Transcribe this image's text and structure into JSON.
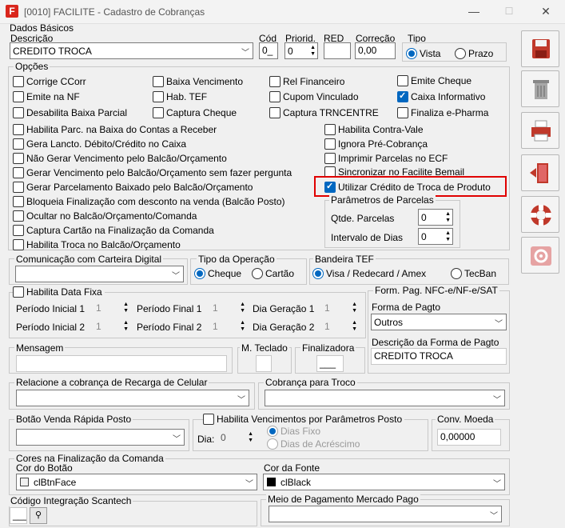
{
  "window": {
    "title": "[0010] FACILITE - Cadastro de Cobranças",
    "icon_letter": "F"
  },
  "dados_basicos": {
    "legend": "Dados Básicos",
    "descricao_label": "Descrição",
    "descricao_value": "CREDITO TROCA",
    "cod_label": "Cód",
    "cod_value": "0_",
    "prioridade_label": "Priorid.",
    "prioridade_value": "0",
    "red_label": "RED",
    "red_value": "",
    "correcao_label": "Correção",
    "correcao_value": "0,00",
    "tipo_label": "Tipo",
    "tipo_vista": "Vista",
    "tipo_prazo": "Prazo"
  },
  "opcoes": {
    "legend": "Opções",
    "row1": [
      "Corrige CCorr",
      "Baixa Vencimento",
      "Rel Financeiro",
      "Emite Cheque"
    ],
    "row2": [
      "Emite na NF",
      "Hab. TEF",
      "Cupom Vinculado",
      "Caixa Informativo"
    ],
    "row3": [
      "Desabilita Baixa Parcial",
      "Captura Cheque",
      "Captura TRNCENTRE",
      "Finaliza e-Pharma"
    ],
    "left": [
      "Habilita Parc. na Baixa do Contas a Receber",
      "Gera Lancto. Débito/Crédito no Caixa",
      "Não Gerar Vencimento pelo Balcão/Orçamento",
      "Gerar Vencimento pelo Balcão/Orçamento sem fazer pergunta",
      "Gerar Parcelamento Baixado pelo Balcão/Orçamento",
      "Bloqueia Finalização com desconto na venda (Balcão Posto)",
      "Ocultar no Balcão/Orçamento/Comanda",
      "Captura Cartão na Finalização da Comanda",
      "Habilita Troca no Balcão/Orçamento"
    ],
    "right": [
      "Habilita Contra-Vale",
      "Ignora Pré-Cobrança",
      "Imprimir Parcelas no ECF",
      "Sincronizar no Facilite Bemail",
      "Utilizar Crédito de Troca de Produto"
    ]
  },
  "parametros_parcelas": {
    "legend": "Parâmetros de Parcelas",
    "qtde_label": "Qtde. Parcelas",
    "qtde_value": "0",
    "intervalo_label": "Intervalo de Dias",
    "intervalo_value": "0"
  },
  "comunicacao": {
    "legend": "Comunicação com Carteira Digital",
    "value": ""
  },
  "tipo_operacao": {
    "legend": "Tipo da Operação",
    "opt1": "Cheque",
    "opt2": "Cartão"
  },
  "bandeira_tef": {
    "legend": "Bandeira TEF",
    "opt1": "Visa / Redecard / Amex",
    "opt2": "TecBan"
  },
  "data_fixa": {
    "legend": "Habilita Data Fixa",
    "pi1": "Período Inicial 1",
    "pi1_v": "1",
    "pf1": "Período Final 1",
    "pf1_v": "1",
    "dg1": "Dia Geração 1",
    "dg1_v": "1",
    "pi2": "Período Inicial 2",
    "pi2_v": "1",
    "pf2": "Período Final 2",
    "pf2_v": "1",
    "dg2": "Dia Geração 2",
    "dg2_v": "1"
  },
  "nfce": {
    "legend": "Form. Pag. NFC-e/NF-e/SAT",
    "forma_label": "Forma de Pagto",
    "forma_value": "Outros",
    "desc_label": "Descrição da Forma de Pagto",
    "desc_value": "CREDITO TROCA"
  },
  "mensagem": {
    "legend": "Mensagem",
    "m_teclado": "M. Teclado",
    "finalizadora": "Finalizadora",
    "finalizadora_value": "___"
  },
  "recarga": {
    "legend": "Relacione a cobrança de Recarga de Celular"
  },
  "troco": {
    "legend": "Cobrança para Troco"
  },
  "botao_venda": {
    "legend": "Botão Venda Rápida Posto"
  },
  "vencimentos": {
    "legend": "Habilita Vencimentos por Parâmetros Posto",
    "dia_label": "Dia:",
    "dia_value": "0",
    "opt1": "Dias Fixo",
    "opt2": "Dias de Acréscimo"
  },
  "conv_moeda": {
    "legend": "Conv. Moeda",
    "value": "0,00000"
  },
  "cores": {
    "legend": "Cores na Finalização da Comanda",
    "cor_botao_label": "Cor do Botão",
    "cor_botao_value": "clBtnFace",
    "cor_fonte_label": "Cor da Fonte",
    "cor_fonte_value": "clBlack"
  },
  "scantech": {
    "legend": "Código Integração Scantech",
    "value": "___"
  },
  "mercado_pago": {
    "legend": "Meio de Pagamento Mercado Pago"
  },
  "sidebar": [
    "save-icon",
    "trash-icon",
    "print-icon",
    "exit-icon",
    "help-lifebuoy-icon",
    "settings-icon"
  ]
}
